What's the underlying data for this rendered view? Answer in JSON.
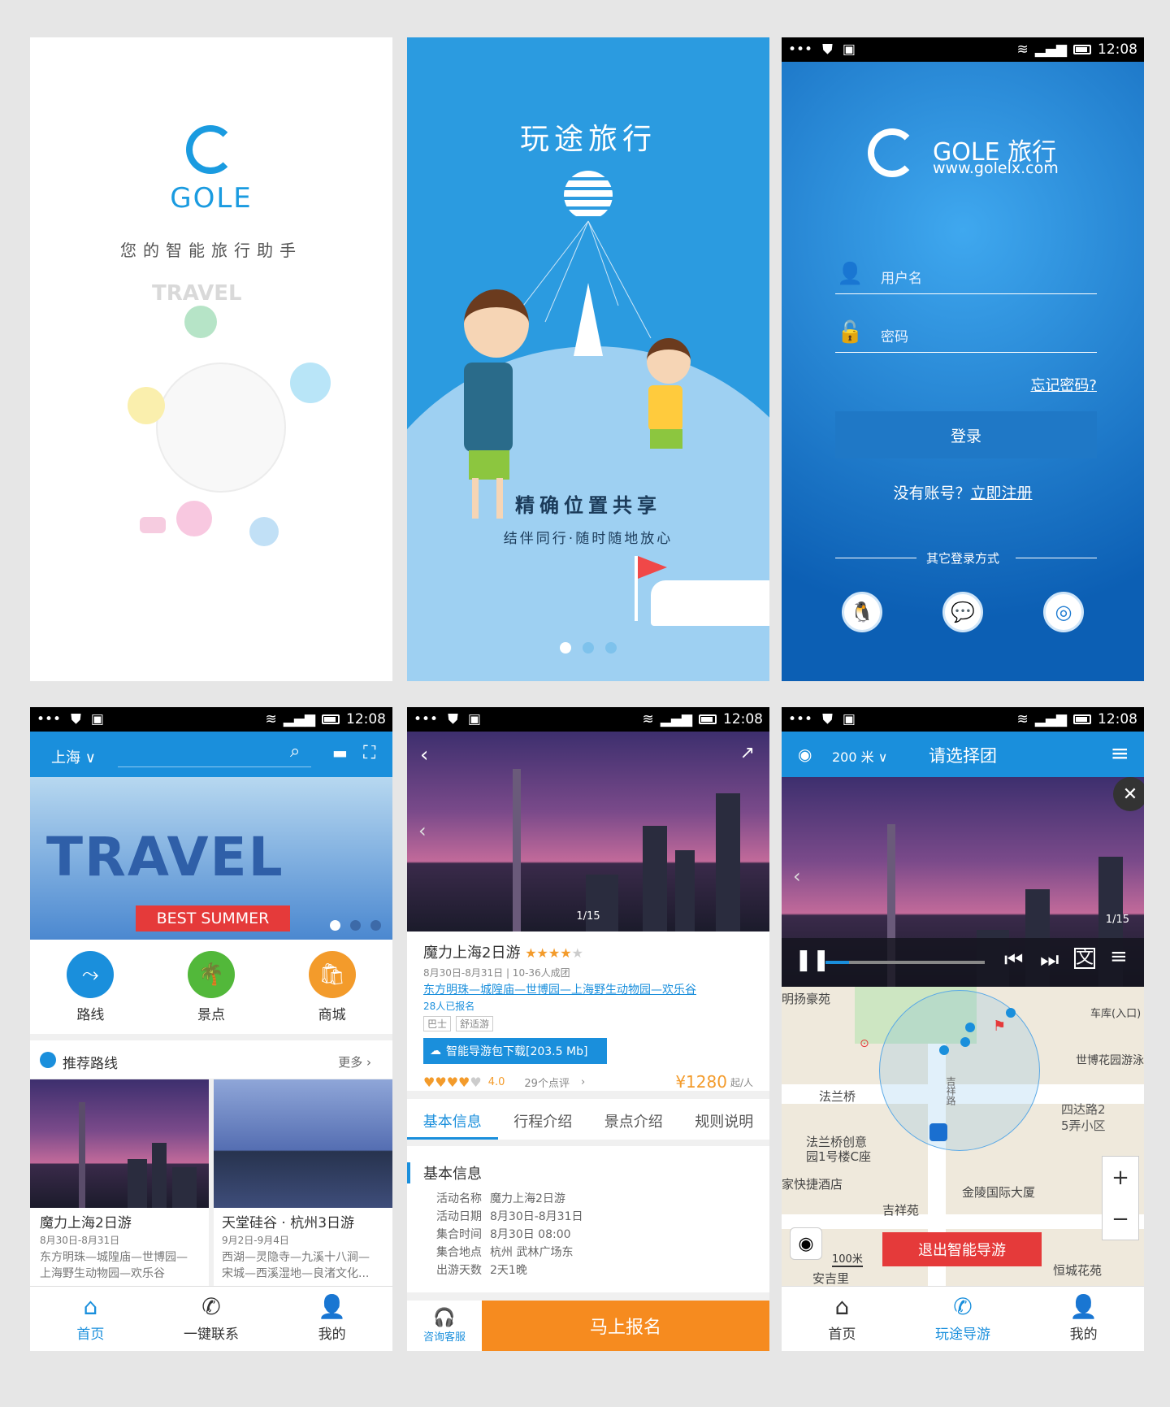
{
  "status": {
    "time": "12:08"
  },
  "splash": {
    "logo_text": "GOLE",
    "tagline": "您的智能旅行助手",
    "travel_word": "TRAVEL"
  },
  "onboard": {
    "title": "玩途旅行",
    "headline": "精确位置共享",
    "subline": "结伴同行·随时随地放心",
    "dots": 3,
    "active": 1
  },
  "login": {
    "brand": "GOLE 旅行",
    "url": "www.golelx.com",
    "username_ph": "用户名",
    "password_ph": "密码",
    "forgot": "忘记密码?",
    "login_btn": "登录",
    "no_account": "没有账号？",
    "register": "立即注册",
    "other": "其它登录方式"
  },
  "home": {
    "city": "上海",
    "banner": "BEST SUMMER",
    "banner_word": "TRAVEL",
    "cats": [
      {
        "label": "路线"
      },
      {
        "label": "景点"
      },
      {
        "label": "商城"
      }
    ],
    "section": "推荐路线",
    "more": "更多",
    "routes": [
      {
        "title": "魔力上海2日游",
        "date": "8月30日-8月31日",
        "desc1": "东方明珠—城隍庙—世博园—",
        "desc2": "上海野生动物园—欢乐谷"
      },
      {
        "title": "天堂硅谷 · 杭州3日游",
        "date": "9月2日-9月4日",
        "desc1": "西湖—灵隐寺—九溪十八涧—",
        "desc2": "宋城—西溪湿地—良渚文化..."
      }
    ],
    "tabs": [
      {
        "label": "首页"
      },
      {
        "label": "一键联系"
      },
      {
        "label": "我的"
      }
    ]
  },
  "detail": {
    "counter": "1/15",
    "title": "魔力上海2日游",
    "meta": "8月30日-8月31日 | 10-36人成团",
    "route": "东方明珠—城隍庙—世博园—上海野生动物园—欢乐谷",
    "signed": "28人已报名",
    "tags": [
      "巴士",
      "舒适游"
    ],
    "download": "智能导游包下载[203.5 Mb]",
    "score": "4.0",
    "reviews": "29个点评",
    "price": "¥1280",
    "price_unit": "起/人",
    "tabs": [
      "基本信息",
      "行程介绍",
      "景点介绍",
      "规则说明"
    ],
    "section": "基本信息",
    "info": [
      {
        "k": "活动名称",
        "v": "魔力上海2日游"
      },
      {
        "k": "活动日期",
        "v": "8月30日-8月31日"
      },
      {
        "k": "集合时间",
        "v": "8月30日 08:00"
      },
      {
        "k": "集合地点",
        "v": "杭州 武林广场东"
      },
      {
        "k": "出游天数",
        "v": "2天1晚"
      }
    ],
    "service": "咨询客服",
    "signup": "马上报名",
    "rating": 4.0,
    "stars": 4
  },
  "guide": {
    "distance": "200 米",
    "title": "请选择团",
    "counter": "1/15",
    "progress": 0.15,
    "places": [
      "明扬豪苑",
      "车库(入口)",
      "世博花园游泳",
      "法兰桥",
      "四达路2",
      "5弄小区",
      "法兰桥创意",
      "园1号楼C座",
      "家快捷酒店",
      "金陵国际大厦",
      "吉祥苑",
      "恒城花苑",
      "安吉里",
      "吉祥路"
    ],
    "scale": "100米",
    "exit": "退出智能导游",
    "tabs": [
      {
        "label": "首页"
      },
      {
        "label": "玩途导游"
      },
      {
        "label": "我的"
      }
    ]
  }
}
